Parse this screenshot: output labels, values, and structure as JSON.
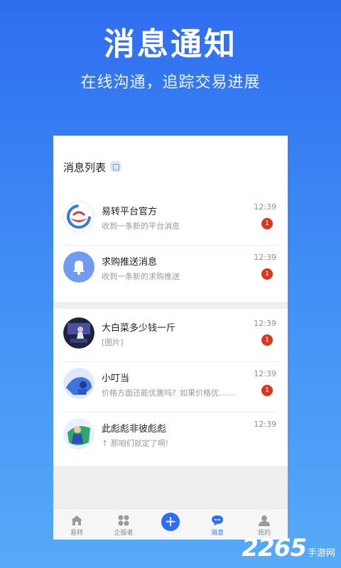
{
  "hero": {
    "title": "消息通知",
    "subtitle": "在线沟通，追踪交易进展"
  },
  "screen": {
    "list_title": "消息列表",
    "system_messages": [
      {
        "name": "易转平台官方",
        "preview": "收到一条新的平台消息",
        "time": "12:39",
        "unread": "1",
        "avatar_icon": "platform-logo-icon"
      },
      {
        "name": "求购推送消息",
        "preview": "收到一条新的求购推送",
        "time": "12:39",
        "unread": "1",
        "avatar_icon": "bell-icon"
      }
    ],
    "chats": [
      {
        "name": "大白菜多少钱一斤",
        "preview": "[图片]",
        "time": "12:39",
        "unread": "1"
      },
      {
        "name": "小叮当",
        "preview": "价格方面还能优惠吗？如果价格优……",
        "time": "12:39",
        "unread": "1"
      },
      {
        "name": "此彪彪非彼彪彪",
        "preview": "那咱们就定了啊!",
        "time": "12:39",
        "unread": ""
      }
    ]
  },
  "tabbar": {
    "items": [
      {
        "label": "易转",
        "icon": "home-icon"
      },
      {
        "label": "企服者",
        "icon": "grid-icon"
      },
      {
        "label": "",
        "icon": "plus-icon"
      },
      {
        "label": "消息",
        "icon": "message-icon",
        "active": true
      },
      {
        "label": "我的",
        "icon": "person-icon"
      }
    ]
  },
  "watermark": {
    "number": "2265",
    "text": "手游网"
  },
  "colors": {
    "primary": "#2f6ef0",
    "badge": "#d9381e",
    "bell_avatar": "#6f9cf0"
  }
}
